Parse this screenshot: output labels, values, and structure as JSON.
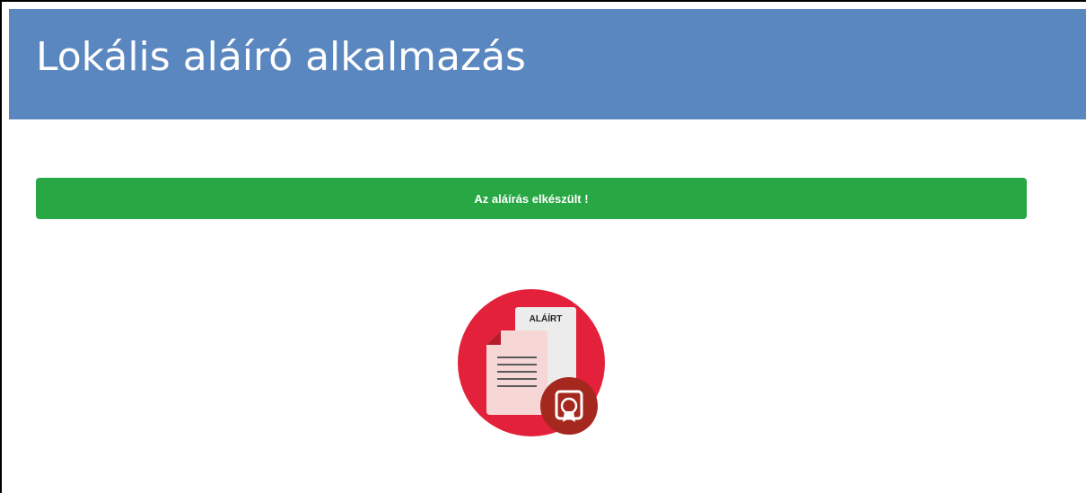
{
  "app": {
    "title": "Lokális aláíró alkalmazás"
  },
  "status": {
    "message": "Az aláírás elkészült !"
  },
  "illustration": {
    "icon": "signed-document-icon",
    "label": "ALÁÍRT"
  },
  "colors": {
    "header_bg": "#5a87bf",
    "success_bg": "#28a745",
    "icon_circle": "#e3213a",
    "seal": "#a5281f"
  }
}
